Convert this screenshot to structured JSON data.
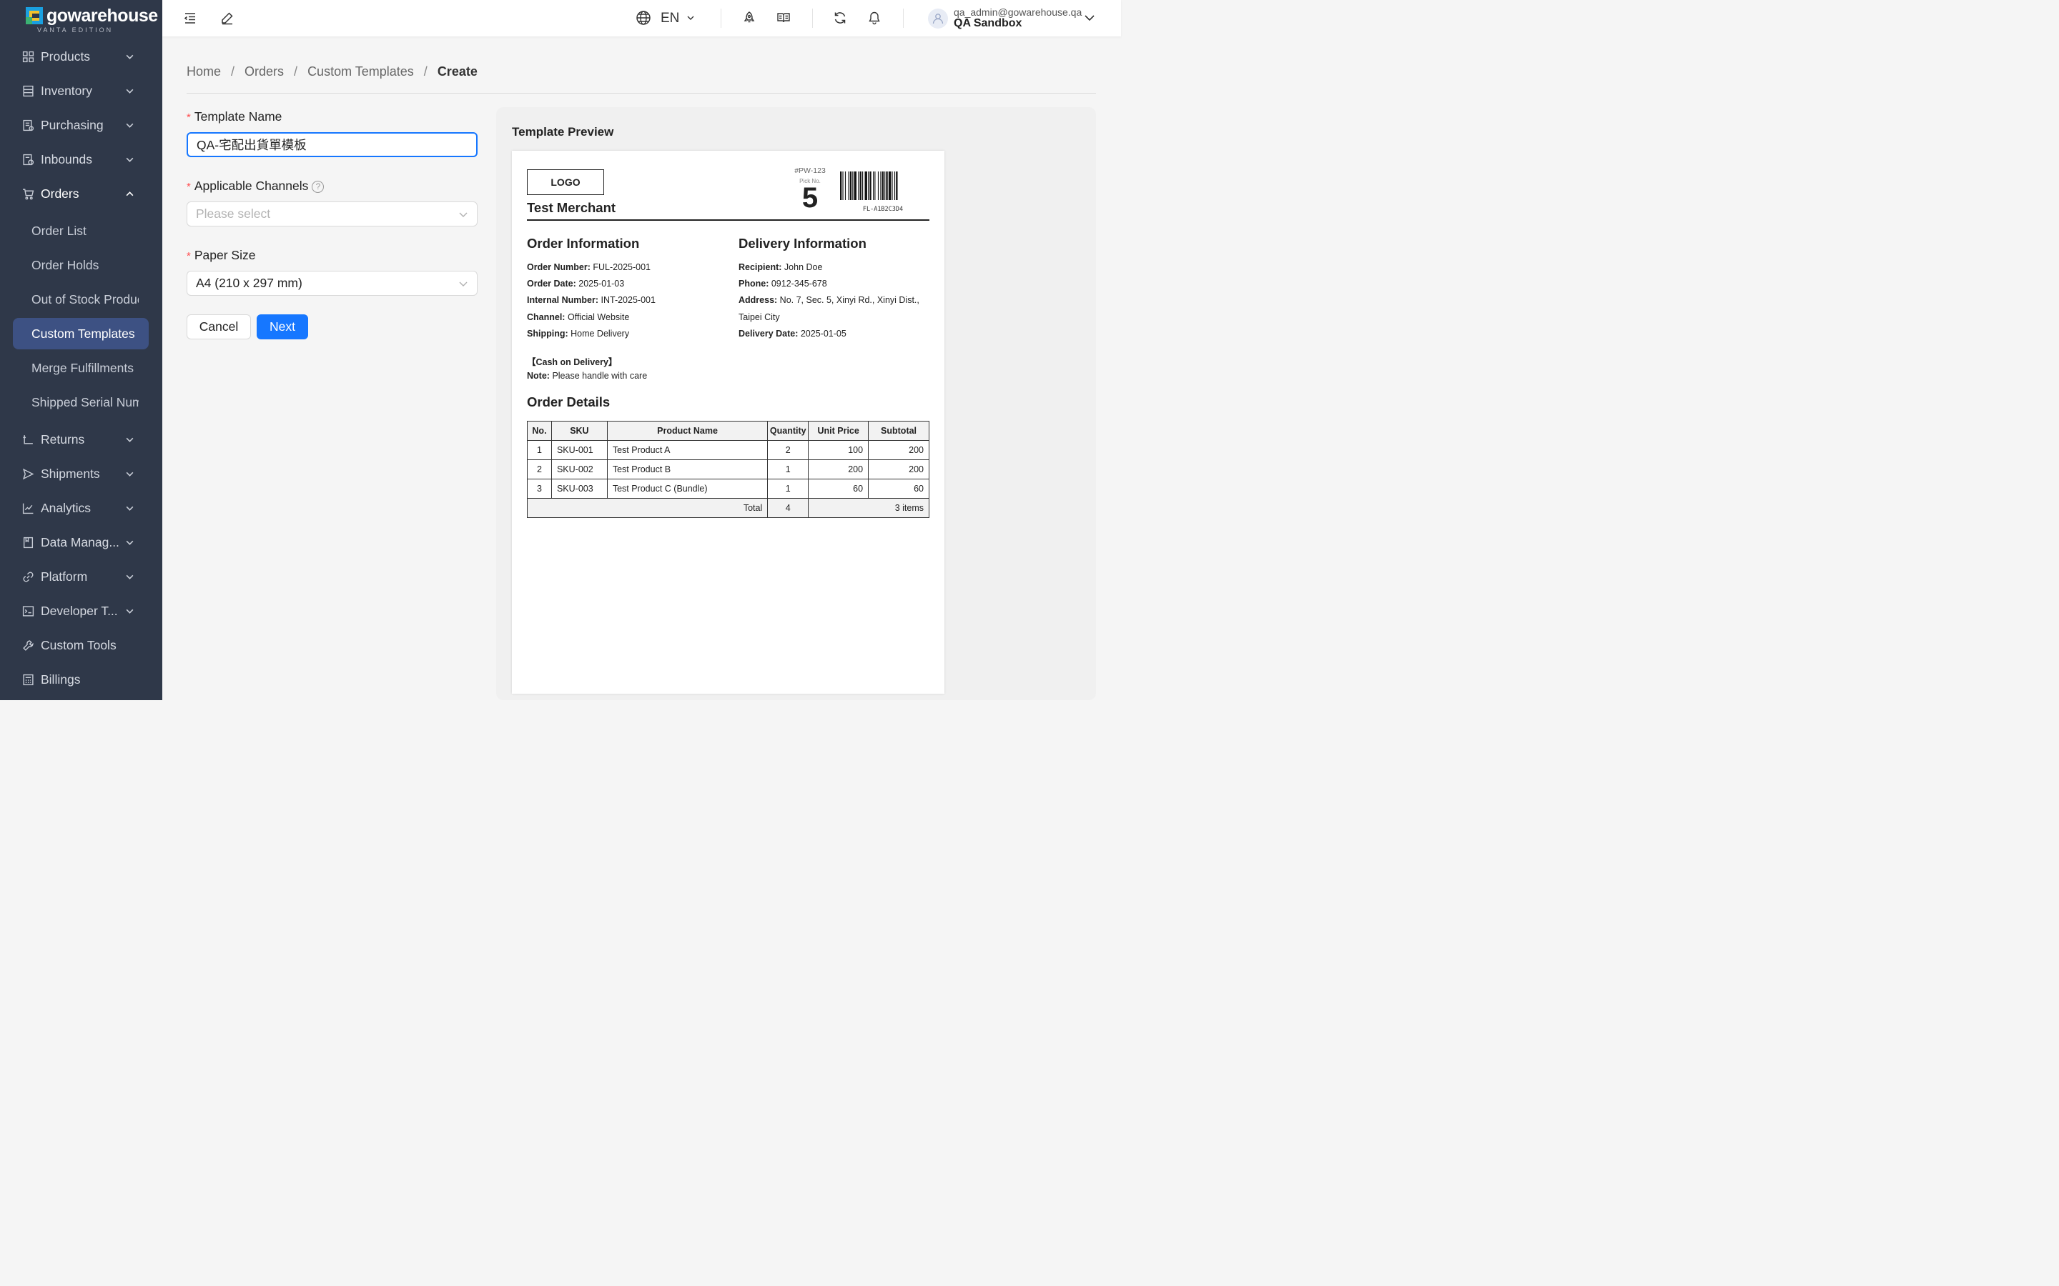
{
  "brand": {
    "name": "gowarehouse",
    "edition": "VANTA EDITION"
  },
  "sidebar": {
    "items": [
      {
        "label": "Products"
      },
      {
        "label": "Inventory"
      },
      {
        "label": "Purchasing"
      },
      {
        "label": "Inbounds"
      },
      {
        "label": "Orders"
      },
      {
        "label": "Returns"
      },
      {
        "label": "Shipments"
      },
      {
        "label": "Analytics"
      },
      {
        "label": "Data Manag..."
      },
      {
        "label": "Platform"
      },
      {
        "label": "Developer T..."
      },
      {
        "label": "Custom Tools"
      },
      {
        "label": "Billings"
      }
    ],
    "orders_sub": [
      {
        "label": "Order List"
      },
      {
        "label": "Order Holds"
      },
      {
        "label": "Out of Stock Products"
      },
      {
        "label": "Custom Templates"
      },
      {
        "label": "Merge Fulfillments"
      },
      {
        "label": "Shipped Serial Numbers"
      }
    ]
  },
  "topbar": {
    "language": "EN",
    "user_email": "qa_admin@gowarehouse.qa",
    "org": "QA Sandbox"
  },
  "breadcrumb": [
    "Home",
    "Orders",
    "Custom Templates",
    "Create"
  ],
  "form": {
    "template_name_label": "Template Name",
    "template_name_value": "QA-宅配出貨單模板",
    "channels_label": "Applicable Channels",
    "channels_placeholder": "Please select",
    "paper_size_label": "Paper Size",
    "paper_size_value": "A4 (210 x 297 mm)",
    "cancel_label": "Cancel",
    "next_label": "Next"
  },
  "preview": {
    "title": "Template Preview",
    "logo": "LOGO",
    "merchant": "Test Merchant",
    "pw": "#PW-123",
    "pick_label": "Pick No.",
    "pick_no": "5",
    "barcode_text": "FL-A1B2C3D4",
    "order_info_title": "Order Information",
    "order_info": [
      {
        "k": "Order Number:",
        "v": "FUL-2025-001"
      },
      {
        "k": "Order Date:",
        "v": "2025-01-03"
      },
      {
        "k": "Internal Number:",
        "v": "INT-2025-001"
      },
      {
        "k": "Channel:",
        "v": "Official Website"
      },
      {
        "k": "Shipping:",
        "v": "Home Delivery"
      }
    ],
    "delivery_title": "Delivery Information",
    "delivery_info": [
      {
        "k": "Recipient:",
        "v": "John Doe"
      },
      {
        "k": "Phone:",
        "v": "0912-345-678"
      },
      {
        "k": "Address:",
        "v": "No. 7, Sec. 5, Xinyi Rd., Xinyi Dist.,"
      },
      {
        "k": "",
        "v": "Taipei City"
      },
      {
        "k": "Delivery Date:",
        "v": "2025-01-05"
      }
    ],
    "cod": "【Cash on Delivery】",
    "note_k": "Note:",
    "note_v": "Please handle with care",
    "details_title": "Order Details",
    "table": {
      "headers": [
        "No.",
        "SKU",
        "Product Name",
        "Quantity",
        "Unit Price",
        "Subtotal"
      ],
      "rows": [
        [
          "1",
          "SKU-001",
          "Test Product A",
          "2",
          "100",
          "200"
        ],
        [
          "2",
          "SKU-002",
          "Test Product B",
          "1",
          "200",
          "200"
        ],
        [
          "3",
          "SKU-003",
          "Test Product C (Bundle)",
          "1",
          "60",
          "60"
        ]
      ],
      "total_label": "Total",
      "total_qty": "4",
      "total_items": "3 items"
    }
  }
}
